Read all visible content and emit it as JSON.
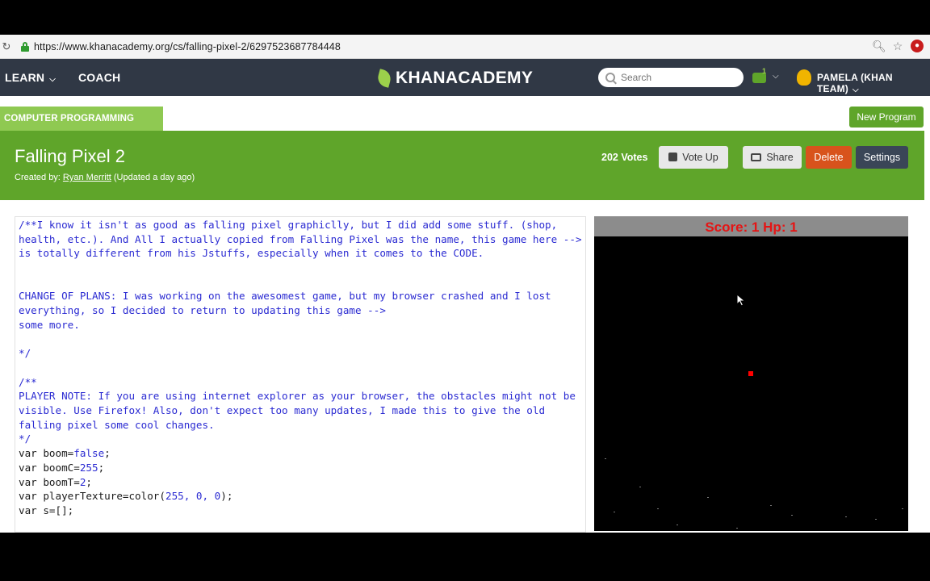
{
  "browser": {
    "url": "https://www.khanacademy.org/cs/falling-pixel-2/6297523687784448"
  },
  "header": {
    "learn_label": "LEARN",
    "coach_label": "COACH",
    "logo_text": "KHANACADEMY",
    "search_placeholder": "Search",
    "notification_count": "1",
    "username": "PAMELA (KHAN TEAM)"
  },
  "subnav": {
    "section_label": "COMPUTER PROGRAMMING",
    "new_program_label": "New Program"
  },
  "program": {
    "title": "Falling Pixel 2",
    "created_prefix": "Created by: ",
    "author": "Ryan Merritt",
    "updated": " (Updated a day ago)",
    "votes": "202 Votes",
    "vote_up_label": "Vote Up",
    "share_label": "Share",
    "delete_label": "Delete",
    "settings_label": "Settings"
  },
  "code_lines": [
    "/**I know it isn't as good as falling pixel graphiclly, but I did add some stuff. (shop, health, etc.). And All I actually copied from Falling Pixel was the name, this game here -->",
    "is totally different from his Jstuffs, especially when it comes to the CODE.",
    "",
    "",
    "CHANGE OF PLANS: I was working on the awesomest game, but my browser crashed and I lost everything, so I decided to return to updating this game -->",
    "some more.",
    "",
    "*/",
    "",
    "/**",
    "PLAYER NOTE: If you are using internet explorer as your browser, the obstacles might not be visible. Use Firefox! Also, don't expect too many updates, I made this to give the old falling pixel some cool changes.",
    "*/"
  ],
  "code_vars": [
    {
      "name": "var boom=",
      "value": "false",
      "end": ";"
    },
    {
      "name": "var boomC=",
      "value": "255",
      "end": ";"
    },
    {
      "name": "var boomT=",
      "value": "2",
      "end": ";"
    },
    {
      "name": "var playerTexture=color(",
      "value": "255, 0, 0",
      "end": ");"
    },
    {
      "name": "var s=[];",
      "value": "",
      "end": ""
    }
  ],
  "game": {
    "score_text": "Score: 1 Hp: 1"
  },
  "colors": {
    "header_bg": "#303845",
    "title_bar_green": "#5fa52a",
    "tab_green": "#8fc952",
    "delete_orange": "#d8531c",
    "score_red": "#e51414"
  }
}
